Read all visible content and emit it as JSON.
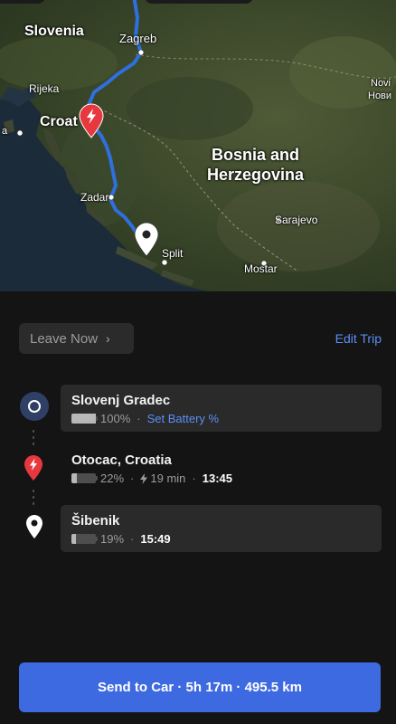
{
  "map": {
    "labels": {
      "slovenia": "Slovenia",
      "zagreb": "Zagreb",
      "rijeka": "Rijeka",
      "croatia": "Croat",
      "zadar": "Zadar",
      "bosnia_line1": "Bosnia and",
      "bosnia_line2": "Herzegovina",
      "sarajevo": "Sarajevo",
      "split": "Split",
      "mostar": "Mostar",
      "novi_line1": "Novi",
      "novi_line2": "Нови",
      "left_edge": "a"
    },
    "route_color": "#2f6fde"
  },
  "trip": {
    "leave_now_label": "Leave Now",
    "leave_now_chevron": "›",
    "edit_trip_label": "Edit Trip",
    "stops": [
      {
        "name": "Slovenj Gradec",
        "battery": "100%",
        "battery_level": 1.0,
        "action": "Set Battery %",
        "icon": "origin-circle-icon"
      },
      {
        "name": "Otocac, Croatia",
        "battery": "22%",
        "battery_level": 0.22,
        "charge_time": "19 min",
        "arrival": "13:45",
        "icon": "supercharger-pin-icon"
      },
      {
        "name": "Šibenik",
        "battery": "19%",
        "battery_level": 0.19,
        "arrival": "15:49",
        "icon": "destination-pin-icon"
      }
    ],
    "separator": "·"
  },
  "send_button": {
    "label": "Send to Car · 5h 17m · 495.5 km",
    "color": "#3e6ae1"
  },
  "colors": {
    "link": "#5b8ef5",
    "charger_red": "#e8383f",
    "background": "#141414",
    "card": "#2a2a2a"
  }
}
